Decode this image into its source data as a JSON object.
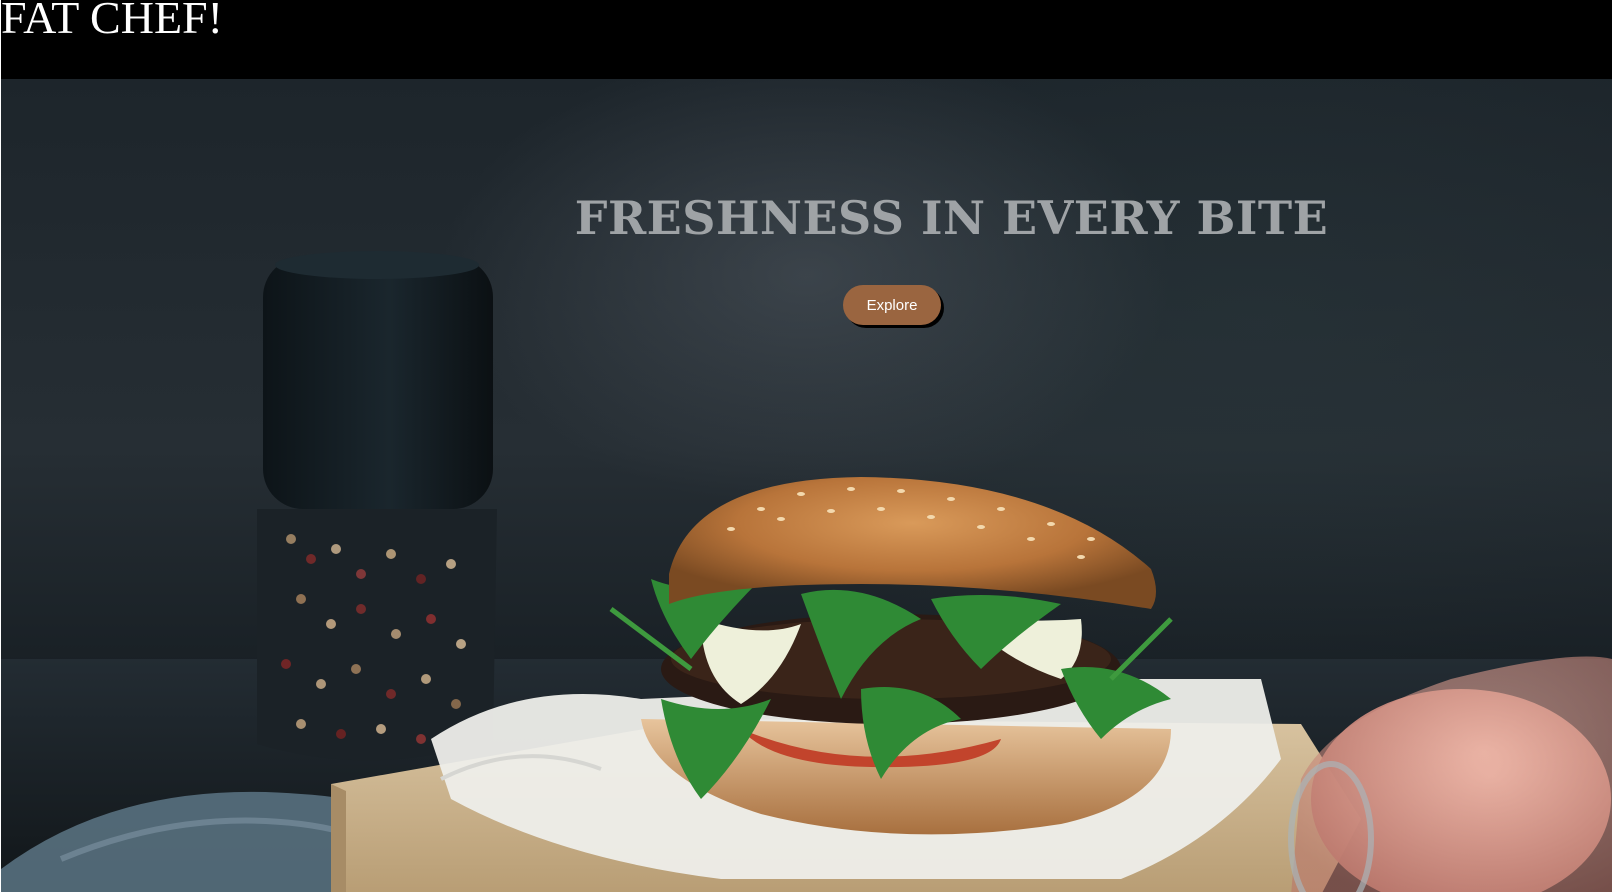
{
  "header": {
    "brand": "FAT CHEF!",
    "background_color": "#000000",
    "text_color": "#ffffff"
  },
  "hero": {
    "headline": "FRESHNESS IN EVERY BITE",
    "headline_color": "#9fa3a6",
    "cta_label": "Explore",
    "cta_color": "#9a6540",
    "background_image": "burger-photo"
  }
}
